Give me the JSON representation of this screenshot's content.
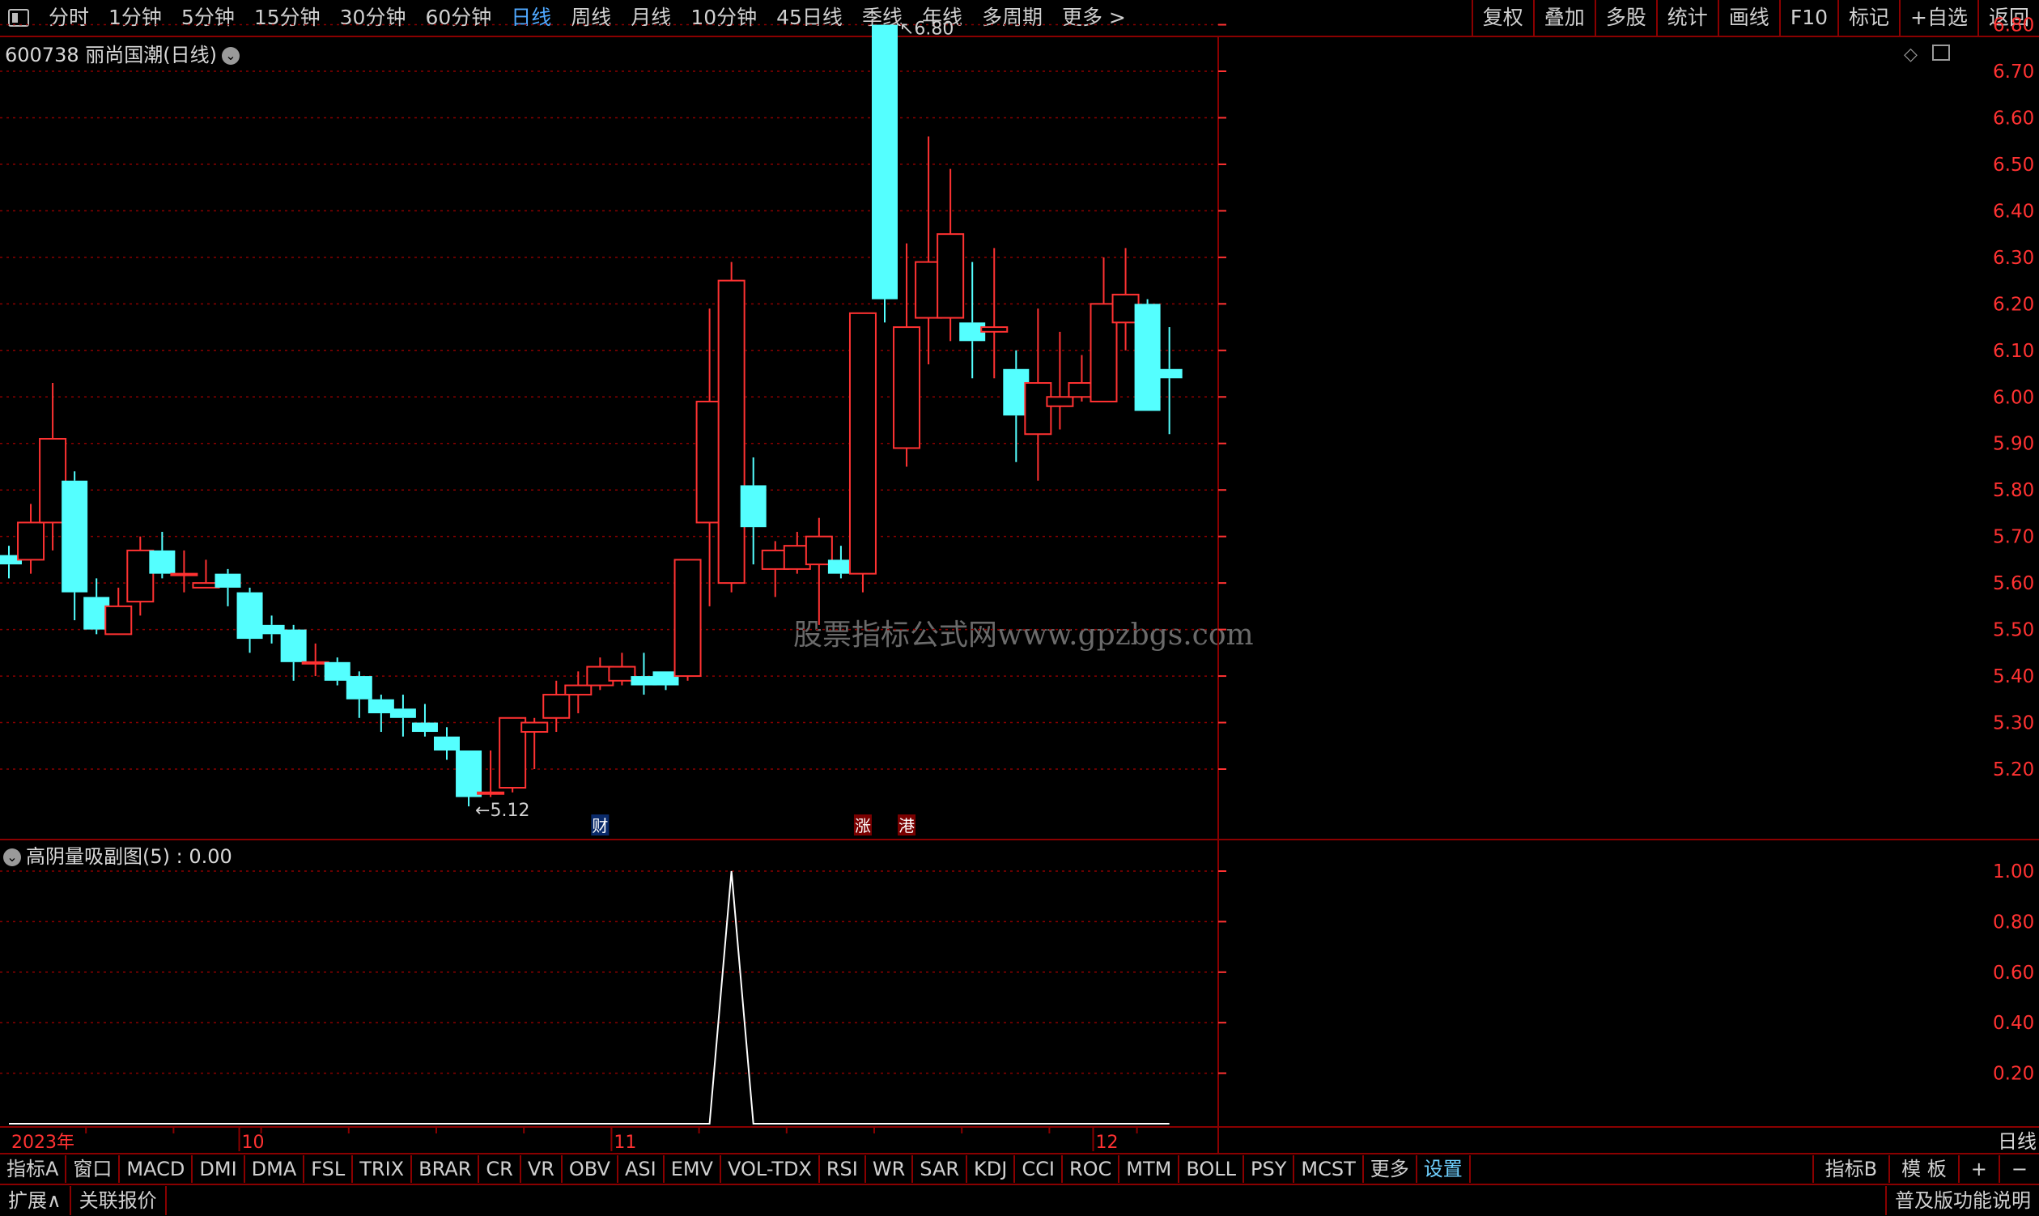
{
  "toolbar": {
    "periods": [
      "分时",
      "1分钟",
      "5分钟",
      "15分钟",
      "30分钟",
      "60分钟",
      "日线",
      "周线",
      "月线",
      "10分钟",
      "45日线",
      "季线",
      "年线",
      "多周期",
      "更多 >"
    ],
    "active_period": "日线",
    "right_tools": [
      "复权",
      "叠加",
      "多股",
      "统计",
      "画线",
      "F10",
      "标记",
      "+自选",
      "返回"
    ]
  },
  "stock": {
    "code": "600738",
    "name": "丽尚国潮",
    "period_label": "(日线)",
    "title": "600738 丽尚国潮(日线)"
  },
  "indicator": {
    "name": "高阴量吸副图(5)",
    "value_text": ": 0.00",
    "title": "高阴量吸副图(5) : 0.00"
  },
  "watermark": "股票指标公式网www.gpzbgs.com",
  "bottom_tabs": [
    "指标A",
    "窗口",
    "MACD",
    "DMI",
    "DMA",
    "FSL",
    "TRIX",
    "BRAR",
    "CR",
    "VR",
    "OBV",
    "ASI",
    "EMV",
    "VOL-TDX",
    "RSI",
    "WR",
    "SAR",
    "KDJ",
    "CCI",
    "ROC",
    "MTM",
    "BOLL",
    "PSY",
    "MCST",
    "更多",
    "设置"
  ],
  "bottom_right": [
    "指标B",
    "模 板",
    "+",
    "−"
  ],
  "status_left": [
    "扩展∧",
    "关联报价"
  ],
  "status_right": "普及版功能说明",
  "period_box": "日线",
  "colors": {
    "up": "#ff3232",
    "down": "#54ffff",
    "grid": "#8a0000",
    "axis": "#ff3232"
  },
  "chart_data": {
    "type": "candlestick",
    "price_axis": {
      "ylim": [
        5.1,
        6.86
      ],
      "ticks": [
        "6.80",
        "6.70",
        "6.60",
        "6.50",
        "6.40",
        "6.30",
        "6.20",
        "6.10",
        "6.00",
        "5.90",
        "5.80",
        "5.70",
        "5.60",
        "5.50",
        "5.40",
        "5.30",
        "5.20"
      ]
    },
    "max_label": "6.80",
    "min_label": "5.12",
    "candles": [
      {
        "o": 5.66,
        "h": 5.68,
        "l": 5.61,
        "c": 5.64
      },
      {
        "o": 5.65,
        "h": 5.77,
        "l": 5.62,
        "c": 5.73
      },
      {
        "o": 5.73,
        "h": 6.03,
        "l": 5.67,
        "c": 5.91
      },
      {
        "o": 5.82,
        "h": 5.84,
        "l": 5.52,
        "c": 5.58
      },
      {
        "o": 5.57,
        "h": 5.61,
        "l": 5.49,
        "c": 5.5
      },
      {
        "o": 5.49,
        "h": 5.59,
        "l": 5.49,
        "c": 5.55
      },
      {
        "o": 5.56,
        "h": 5.7,
        "l": 5.53,
        "c": 5.67
      },
      {
        "o": 5.67,
        "h": 5.71,
        "l": 5.61,
        "c": 5.62
      },
      {
        "o": 5.62,
        "h": 5.67,
        "l": 5.58,
        "c": 5.62
      },
      {
        "o": 5.59,
        "h": 5.65,
        "l": 5.59,
        "c": 5.6
      },
      {
        "o": 5.62,
        "h": 5.63,
        "l": 5.55,
        "c": 5.59
      },
      {
        "o": 5.58,
        "h": 5.59,
        "l": 5.45,
        "c": 5.48
      },
      {
        "o": 5.51,
        "h": 5.53,
        "l": 5.47,
        "c": 5.49
      },
      {
        "o": 5.5,
        "h": 5.51,
        "l": 5.39,
        "c": 5.43
      },
      {
        "o": 5.43,
        "h": 5.47,
        "l": 5.4,
        "c": 5.43
      },
      {
        "o": 5.43,
        "h": 5.44,
        "l": 5.38,
        "c": 5.39
      },
      {
        "o": 5.4,
        "h": 5.41,
        "l": 5.31,
        "c": 5.35
      },
      {
        "o": 5.35,
        "h": 5.36,
        "l": 5.28,
        "c": 5.32
      },
      {
        "o": 5.33,
        "h": 5.36,
        "l": 5.27,
        "c": 5.31
      },
      {
        "o": 5.3,
        "h": 5.34,
        "l": 5.27,
        "c": 5.28
      },
      {
        "o": 5.27,
        "h": 5.29,
        "l": 5.22,
        "c": 5.24
      },
      {
        "o": 5.24,
        "h": 5.24,
        "l": 5.12,
        "c": 5.14
      },
      {
        "o": 5.15,
        "h": 5.24,
        "l": 5.14,
        "c": 5.15
      },
      {
        "o": 5.16,
        "h": 5.31,
        "l": 5.15,
        "c": 5.31
      },
      {
        "o": 5.28,
        "h": 5.31,
        "l": 5.2,
        "c": 5.3
      },
      {
        "o": 5.31,
        "h": 5.39,
        "l": 5.28,
        "c": 5.36
      },
      {
        "o": 5.36,
        "h": 5.41,
        "l": 5.32,
        "c": 5.38
      },
      {
        "o": 5.38,
        "h": 5.44,
        "l": 5.37,
        "c": 5.42
      },
      {
        "o": 5.39,
        "h": 5.45,
        "l": 5.38,
        "c": 5.42
      },
      {
        "o": 5.4,
        "h": 5.45,
        "l": 5.36,
        "c": 5.38
      },
      {
        "o": 5.41,
        "h": 5.41,
        "l": 5.37,
        "c": 5.38
      },
      {
        "o": 5.4,
        "h": 5.65,
        "l": 5.39,
        "c": 5.65
      },
      {
        "o": 5.73,
        "h": 6.19,
        "l": 5.55,
        "c": 5.99
      },
      {
        "o": 5.6,
        "h": 6.29,
        "l": 5.58,
        "c": 6.25
      },
      {
        "o": 5.81,
        "h": 5.87,
        "l": 5.64,
        "c": 5.72
      },
      {
        "o": 5.63,
        "h": 5.69,
        "l": 5.57,
        "c": 5.67
      },
      {
        "o": 5.63,
        "h": 5.71,
        "l": 5.62,
        "c": 5.68
      },
      {
        "o": 5.64,
        "h": 5.74,
        "l": 5.51,
        "c": 5.7
      },
      {
        "o": 5.65,
        "h": 5.68,
        "l": 5.61,
        "c": 5.62
      },
      {
        "o": 5.62,
        "h": 6.18,
        "l": 5.58,
        "c": 6.18
      },
      {
        "o": 6.8,
        "h": 6.8,
        "l": 6.16,
        "c": 6.21
      },
      {
        "o": 5.89,
        "h": 6.33,
        "l": 5.85,
        "c": 6.15
      },
      {
        "o": 6.17,
        "h": 6.56,
        "l": 6.07,
        "c": 6.29
      },
      {
        "o": 6.17,
        "h": 6.49,
        "l": 6.12,
        "c": 6.35
      },
      {
        "o": 6.16,
        "h": 6.29,
        "l": 6.04,
        "c": 6.12
      },
      {
        "o": 6.14,
        "h": 6.32,
        "l": 6.04,
        "c": 6.15
      },
      {
        "o": 6.06,
        "h": 6.1,
        "l": 5.86,
        "c": 5.96
      },
      {
        "o": 5.92,
        "h": 6.19,
        "l": 5.82,
        "c": 6.03
      },
      {
        "o": 5.98,
        "h": 6.14,
        "l": 5.93,
        "c": 6.0
      },
      {
        "o": 6.0,
        "h": 6.09,
        "l": 5.99,
        "c": 6.03
      },
      {
        "o": 5.99,
        "h": 6.3,
        "l": 5.99,
        "c": 6.2
      },
      {
        "o": 6.16,
        "h": 6.32,
        "l": 6.1,
        "c": 6.22
      },
      {
        "o": 6.2,
        "h": 6.21,
        "l": 5.97,
        "c": 5.97
      },
      {
        "o": 6.06,
        "h": 6.15,
        "l": 5.92,
        "c": 6.04
      }
    ],
    "x_labels": [
      {
        "text": "2023年",
        "index": 0
      },
      {
        "text": "10",
        "index": 11
      },
      {
        "text": "11",
        "index": 28
      },
      {
        "text": "12",
        "index": 50
      }
    ],
    "event_markers": [
      {
        "text": "财",
        "index": 27,
        "style": "blue"
      },
      {
        "text": "涨",
        "index": 39,
        "style": "red"
      },
      {
        "text": "港",
        "index": 41,
        "style": "red"
      }
    ],
    "indicator": {
      "name": "高阴量吸副图(5)",
      "ylim": [
        0,
        1.05
      ],
      "ticks": [
        "1.00",
        "0.80",
        "0.60",
        "0.40",
        "0.20"
      ],
      "values": [
        0,
        0,
        0,
        0,
        0,
        0,
        0,
        0,
        0,
        0,
        0,
        0,
        0,
        0,
        0,
        0,
        0,
        0,
        0,
        0,
        0,
        0,
        0,
        0,
        0,
        0,
        0,
        0,
        0,
        0,
        0,
        0,
        0,
        1,
        0,
        0,
        0,
        0,
        0,
        0,
        0,
        0,
        0,
        0,
        0,
        0,
        0,
        0,
        0,
        0,
        0,
        0,
        0,
        0
      ]
    }
  }
}
